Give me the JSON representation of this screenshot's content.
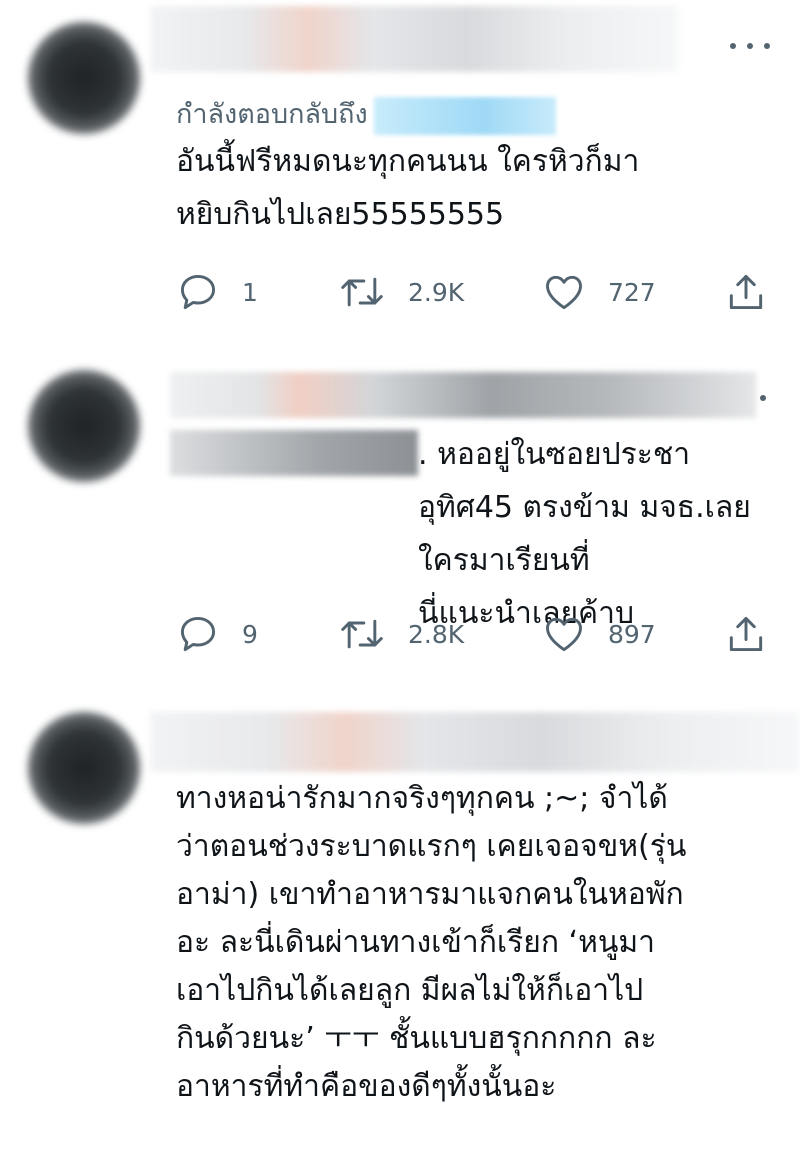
{
  "tweets": [
    {
      "reply_label": "กำลังตอบกลับถึง",
      "text": "อันนี้ฟรีหมดนะทุกคนนน ใครหิวก็มา\nหยิบกินไปเลย55555555",
      "replies": "1",
      "retweets": "2.9K",
      "likes": "727"
    },
    {
      "text": ". หออยู่ในซอยประชา\nอุทิศ45 ตรงข้าม มจธ.เลยใครมาเรียนที่\nนี่แนะนำเลยค้าบ",
      "replies": "9",
      "retweets": "2.8K",
      "likes": "897"
    },
    {
      "text": "ทางหอน่ารักมากจริงๆทุกคน ;~; จำได้\nว่าตอนช่วงระบาดแรกๆ เคยเจอจขห(รุ่น\nอาม่า) เขาทำอาหารมาแจกคนในหอพัก\nอะ ละนี่เดินผ่านทางเข้าก็เรียก ‘หนูมา\nเอาไปกินได้เลยลูก มีผลไม่ให้ก็เอาไป\nกินด้วยนะ’ ㅜㅜ ชั้นแบบฮรุกกกกก ละ\nอาหารที่ทำคือของดีๆทั้งนั้นอะ"
    }
  ],
  "icons": {
    "reply": "speech-bubble",
    "retweet": "retweet-arrows",
    "like": "heart",
    "share": "share-upload"
  },
  "colors": {
    "text": "#0f1419",
    "secondary": "#536471",
    "mention_blur": "#9fd9f6"
  }
}
